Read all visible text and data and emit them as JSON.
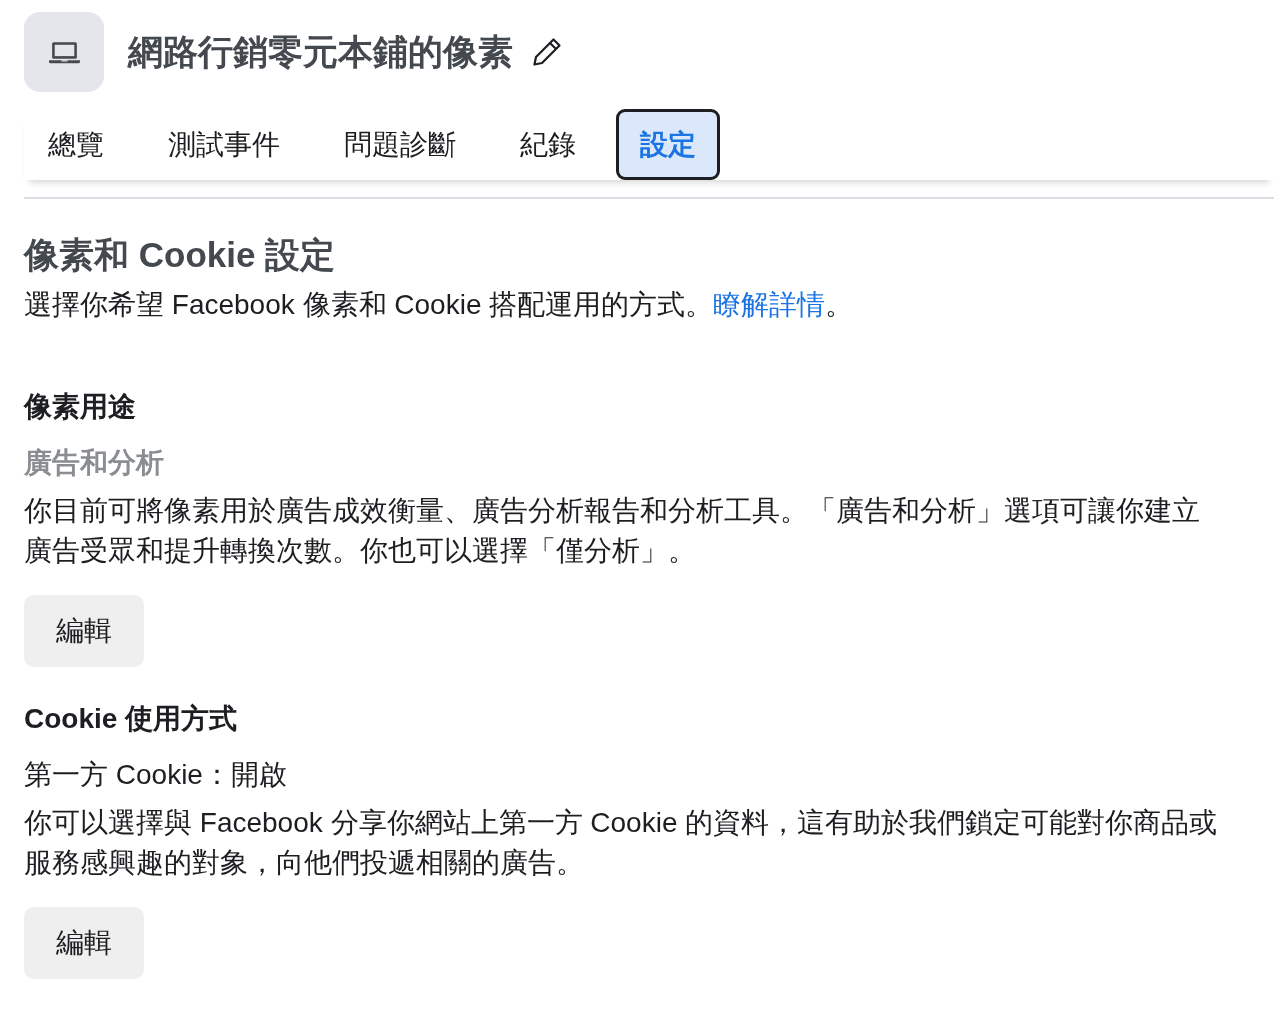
{
  "header": {
    "title": "網路行銷零元本鋪的像素"
  },
  "tabs": [
    {
      "label": "總覽",
      "selected": false
    },
    {
      "label": "測試事件",
      "selected": false
    },
    {
      "label": "問題診斷",
      "selected": false
    },
    {
      "label": "紀錄",
      "selected": false
    },
    {
      "label": "設定",
      "selected": true
    }
  ],
  "intro": {
    "title": "像素和 Cookie 設定",
    "text": "選擇你希望 Facebook 像素和 Cookie 搭配運用的方式。",
    "link": "瞭解詳情",
    "text_after": "。"
  },
  "sections": [
    {
      "heading": "像素用途",
      "value": {
        "kind": "category",
        "text": "廣告和分析"
      },
      "description": "你目前可將像素用於廣告成效衡量、廣告分析報告和分析工具。「廣告和分析」選項可讓你建立廣告受眾和提升轉換次數。你也可以選擇「僅分析」。",
      "button": "編輯"
    },
    {
      "heading": "Cookie 使用方式",
      "value": {
        "kind": "setting",
        "text": "第一方 Cookie：開啟"
      },
      "description": "你可以選擇與 Facebook 分享你網站上第一方 Cookie 的資料，這有助於我們鎖定可能對你商品或服務感興趣的對象，向他們投遞相關的廣告。",
      "button": "編輯"
    }
  ]
}
